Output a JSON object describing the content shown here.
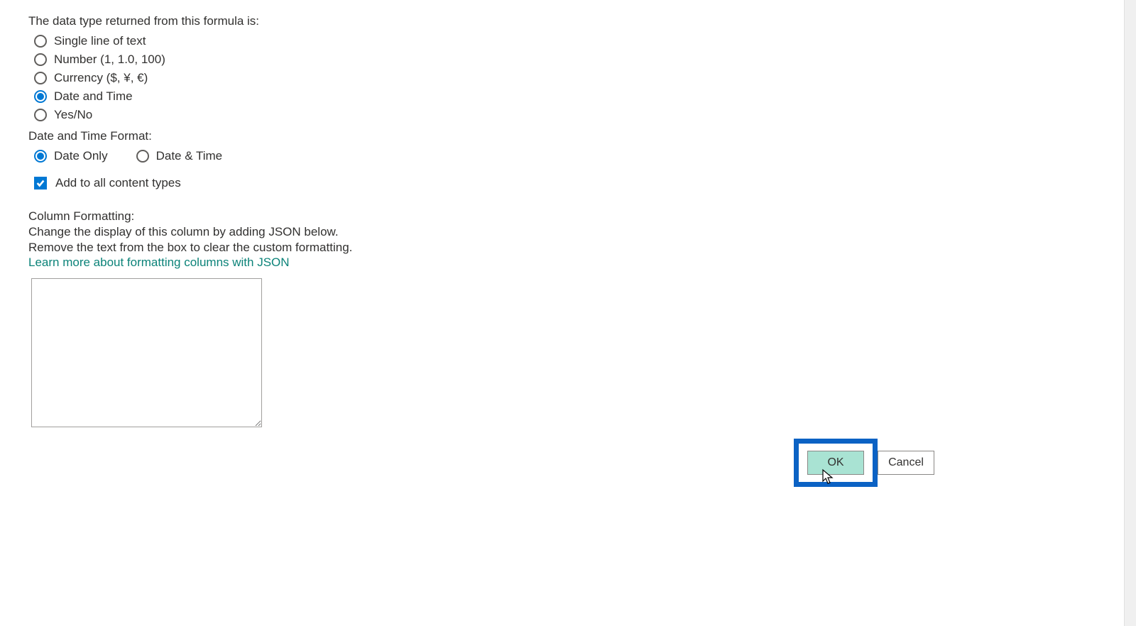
{
  "dataTypeSection": {
    "label": "The data type returned from this formula is:",
    "options": [
      {
        "label": "Single line of text",
        "selected": false
      },
      {
        "label": "Number (1, 1.0, 100)",
        "selected": false
      },
      {
        "label": "Currency ($, ¥, €)",
        "selected": false
      },
      {
        "label": "Date and Time",
        "selected": true
      },
      {
        "label": "Yes/No",
        "selected": false
      }
    ]
  },
  "dateTimeFormat": {
    "label": "Date and Time Format:",
    "options": [
      {
        "label": "Date Only",
        "selected": true
      },
      {
        "label": "Date & Time",
        "selected": false
      }
    ]
  },
  "addToContent": {
    "label": "Add to all content types",
    "checked": true
  },
  "columnFormatting": {
    "heading": "Column Formatting:",
    "line1": "Change the display of this column by adding JSON below.",
    "line2": "Remove the text from the box to clear the custom formatting.",
    "link": "Learn more about formatting columns with JSON",
    "textareaValue": ""
  },
  "buttons": {
    "ok": "OK",
    "cancel": "Cancel"
  }
}
